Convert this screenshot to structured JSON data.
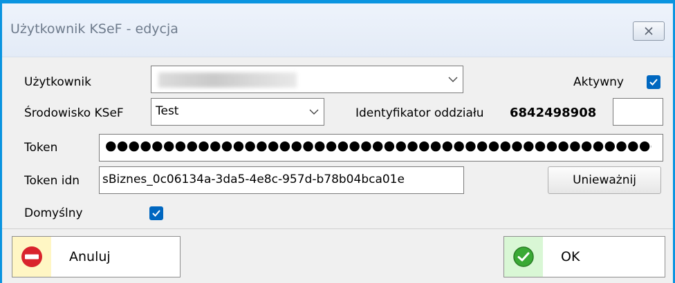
{
  "window": {
    "title": "Użytkownik KSeF - edycja"
  },
  "form": {
    "user_label": "Użytkownik",
    "user_value": "",
    "active_label": "Aktywny",
    "active_checked": true,
    "env_label": "Środowisko KSeF",
    "env_value": "Test",
    "branch_label": "Identyfikator oddziału",
    "branch_value": "6842498908",
    "branch_extra": "",
    "token_label": "Token",
    "token_value": "●●●●●●●●●●●●●●●●●●●●●●●●●●●●●●●●●●●●●●●●●●●●●●●●●●●●●●●●●●●●●●●●",
    "token_idn_label": "Token idn",
    "token_idn_value": "sBiznes_0c06134a-3da5-4e8c-957d-b78b04bca01e",
    "invalidate_label": "Unieważnij",
    "default_label": "Domyślny",
    "default_checked": true
  },
  "footer": {
    "cancel_label": "Anuluj",
    "ok_label": "OK"
  },
  "colors": {
    "accent": "#0067c0",
    "window_border": "#0a94e0",
    "cancel_icon": "#d9232d",
    "ok_icon": "#3aa935"
  },
  "icons": {
    "close": "close-icon",
    "dropdown": "chevron-down-icon",
    "check": "check-icon",
    "cancel": "no-entry-icon",
    "ok": "check-circle-icon"
  }
}
